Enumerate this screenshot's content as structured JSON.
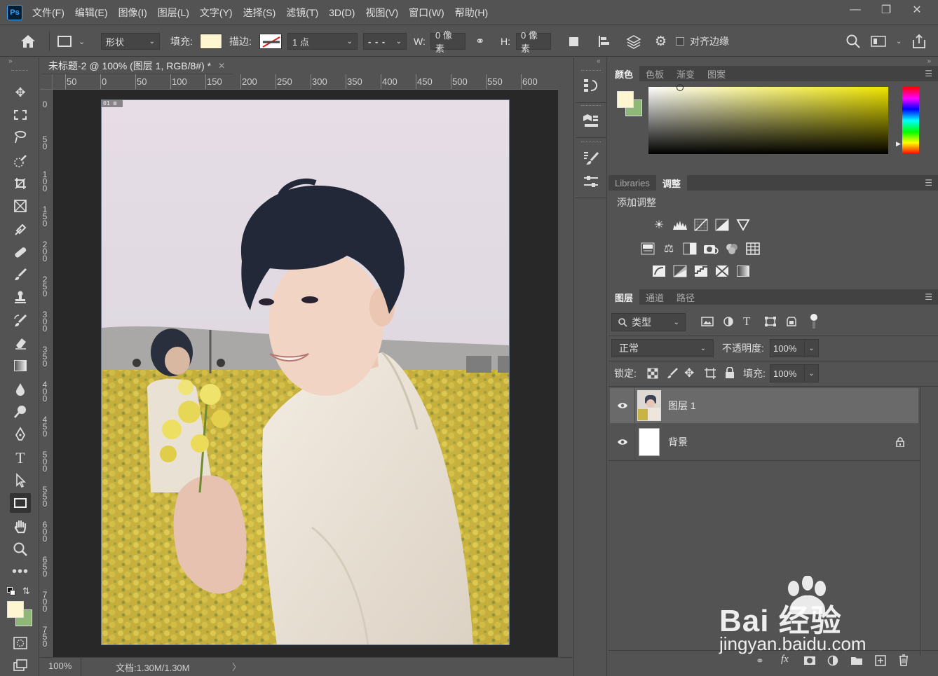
{
  "app": {
    "logo": "Ps",
    "menus": [
      "文件(F)",
      "编辑(E)",
      "图像(I)",
      "图层(L)",
      "文字(Y)",
      "选择(S)",
      "滤镜(T)",
      "3D(D)",
      "视图(V)",
      "窗口(W)",
      "帮助(H)"
    ]
  },
  "options": {
    "mode": "形状",
    "fill_label": "填充:",
    "fill_color": "#fdf6d0",
    "stroke_label": "描边:",
    "stroke_width": "1 点",
    "w_label": "W:",
    "w_value": "0 像素",
    "h_label": "H:",
    "h_value": "0 像素",
    "align_edges": "对齐边缘"
  },
  "document": {
    "tab_title": "未标题-2 @ 100% (图层 1, RGB/8#) *",
    "ruler_h": [
      "50",
      "0",
      "50",
      "100",
      "150",
      "200",
      "250",
      "300",
      "350",
      "400",
      "450",
      "500",
      "550",
      "600"
    ],
    "ruler_v": [
      "0",
      "5 0",
      "1 0 0",
      "1 5 0",
      "2 0 0",
      "2 5 0",
      "3 0 0",
      "3 5 0",
      "4 0 0",
      "4 5 0",
      "5 0 0",
      "5 5 0",
      "6 0 0",
      "6 5 0",
      "7 0 0",
      "7 5 0"
    ],
    "corner_badge": "01 ⊠",
    "zoom": "100%",
    "doc_size": "文档:1.30M/1.30M"
  },
  "panels": {
    "color_tabs": [
      "颜色",
      "色板",
      "渐变",
      "图案"
    ],
    "fg_color": "#fdf6d0",
    "bg_color": "#8fb878",
    "picker_hue": "#f0e600",
    "adj_tabs": [
      "Libraries",
      "调整"
    ],
    "add_adjustment": "添加调整",
    "layer_tabs": [
      "图层",
      "通道",
      "路径"
    ],
    "filter_kind": "类型",
    "blend_mode": "正常",
    "opacity_label": "不透明度:",
    "opacity_value": "100%",
    "lock_label": "锁定:",
    "fill_label": "填充:",
    "fill_value": "100%",
    "layers": [
      {
        "name": "图层 1",
        "selected": true
      },
      {
        "name": "背景",
        "selected": false
      }
    ],
    "footer_icons": [
      "link-icon",
      "fx-icon",
      "mask-icon",
      "adjustment-icon",
      "folder-icon",
      "new-layer-icon",
      "trash-icon"
    ]
  },
  "watermark": {
    "brand": "Bai 经验",
    "url": "jingyan.baidu.com"
  }
}
